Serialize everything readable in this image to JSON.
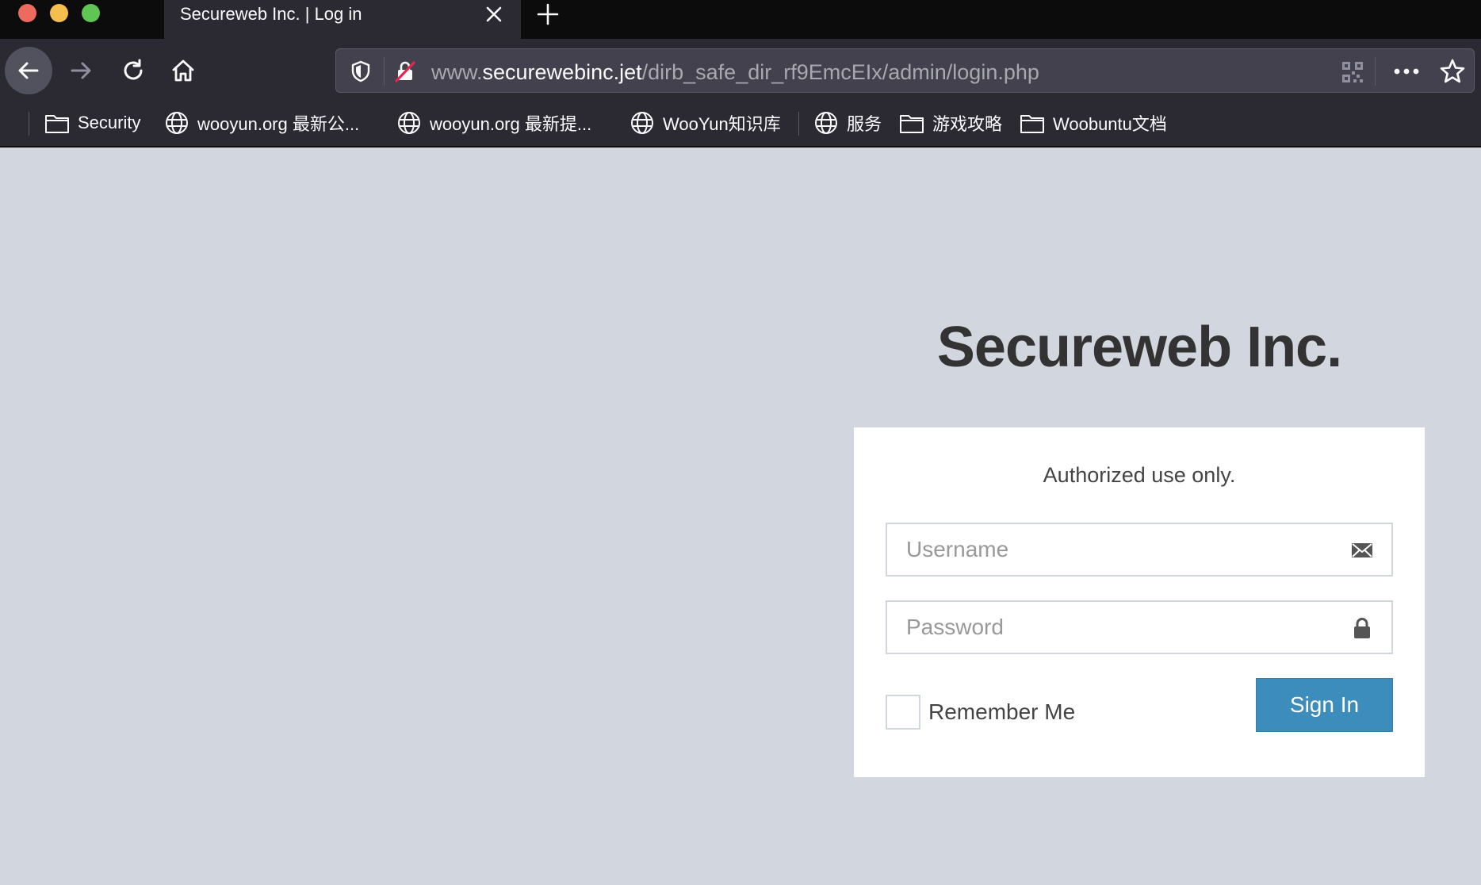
{
  "browser": {
    "tab": {
      "title": "Secureweb Inc. | Log in"
    },
    "url": {
      "prefix": "www.",
      "host": "securewebinc.jet",
      "path": "/dirb_safe_dir_rf9EmcEIx/admin/login.php"
    },
    "bookmarks": [
      {
        "label": "Security",
        "icon": "folder-icon"
      },
      {
        "label": "wooyun.org 最新公...",
        "icon": "globe-icon"
      },
      {
        "label": "wooyun.org 最新提...",
        "icon": "globe-icon"
      },
      {
        "label": "WooYun知识库",
        "icon": "globe-icon"
      },
      {
        "label": "服务",
        "icon": "globe-icon"
      },
      {
        "label": "游戏攻略",
        "icon": "folder-icon"
      },
      {
        "label": "Woobuntu文档",
        "icon": "folder-icon"
      }
    ]
  },
  "page": {
    "brand": "Secureweb Inc.",
    "login": {
      "message": "Authorized use only.",
      "username_placeholder": "Username",
      "password_placeholder": "Password",
      "remember_label": "Remember Me",
      "signin_label": "Sign In"
    }
  },
  "colors": {
    "background": "#d2d6de",
    "primary_button": "#3c8dbc",
    "chrome_dark": "#2b2a33"
  }
}
